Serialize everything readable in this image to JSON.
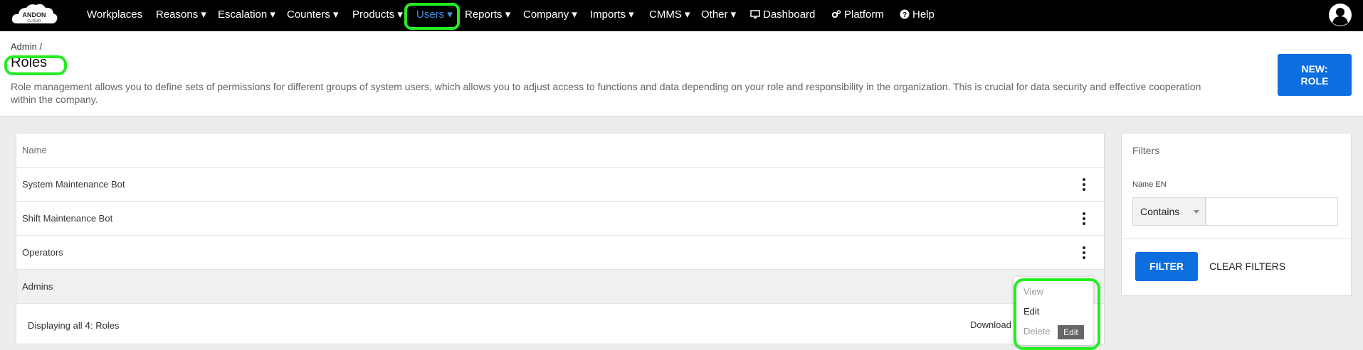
{
  "nav": {
    "items": [
      {
        "label": "Workplaces"
      },
      {
        "label": "Reasons ▾"
      },
      {
        "label": "Escalation ▾"
      },
      {
        "label": "Counters ▾"
      },
      {
        "label": "Products ▾"
      },
      {
        "label": "Users ▾"
      },
      {
        "label": "Reports ▾"
      },
      {
        "label": "Company ▾"
      },
      {
        "label": "Imports ▾"
      },
      {
        "label": "CMMS ▾"
      },
      {
        "label": "Other ▾"
      },
      {
        "label": "Dashboard"
      },
      {
        "label": "Platform"
      },
      {
        "label": "Help"
      }
    ],
    "active": "Users",
    "logo_text_top": "ANDON",
    "logo_text_bottom": "CLOUD",
    "active_color": "#4a90e2"
  },
  "header": {
    "breadcrumb": "Admin /",
    "title": "Roles",
    "description": "Role management allows you to define sets of permissions for different groups of system users, which allows you to adjust access to functions and data depending on your role and responsibility in the organization. This is crucial for data security and effective cooperation within the company.",
    "new_button_line1": "NEW:",
    "new_button_line2": "ROLE"
  },
  "table": {
    "column_name": "Name",
    "rows": [
      {
        "name": "System Maintenance Bot"
      },
      {
        "name": "Shift Maintenance Bot"
      },
      {
        "name": "Operators"
      },
      {
        "name": "Admins"
      }
    ],
    "footer_prefix": "Displaying all",
    "footer_count": "4",
    "footer_suffix": ": Roles",
    "download_label": "Download"
  },
  "row_menu": {
    "view": "View",
    "edit": "Edit",
    "delete": "Delete",
    "tooltip": "Edit"
  },
  "filters": {
    "title": "Filters",
    "field_label": "Name EN",
    "operator_value": "Contains",
    "input_value": "",
    "filter_button": "FILTER",
    "clear_button": "CLEAR FILTERS"
  },
  "colors": {
    "primary": "#0d6ee0",
    "highlight": "#22ee22",
    "nav_bg": "#000000"
  }
}
